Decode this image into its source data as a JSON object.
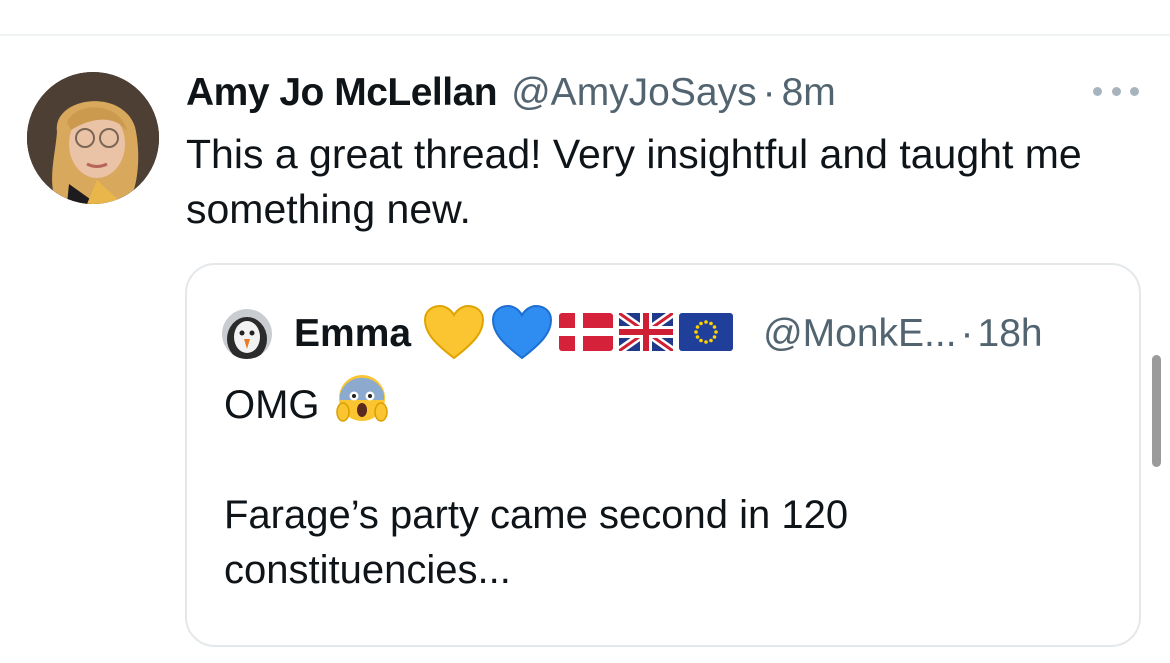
{
  "tweet": {
    "author_name": "Amy Jo McLellan",
    "handle": "@AmyJoSays",
    "separator": "·",
    "time": "8m",
    "text": "This a great thread! Very insightful and taught me something new."
  },
  "quoted": {
    "author_name": "Emma",
    "handle": "@MonkE...",
    "separator": "·",
    "time": "18h",
    "line1": "OMG",
    "line2": "Farage’s party came second in 120 constituencies...",
    "emojis": [
      "yellow-heart-icon",
      "blue-heart-icon",
      "denmark-flag-icon",
      "uk-flag-icon",
      "eu-flag-icon",
      "screaming-face-icon"
    ]
  },
  "colors": {
    "text": "#0f1419",
    "muted": "#536471",
    "border": "#e4e8eb"
  }
}
